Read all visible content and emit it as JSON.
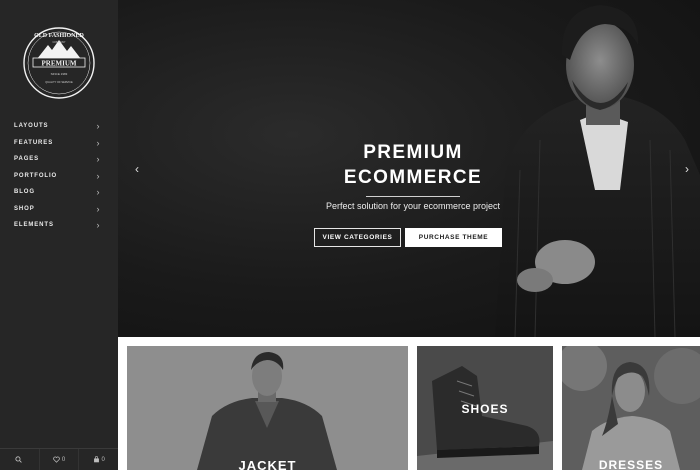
{
  "logo": {
    "brand_top": "OLD FASHIONED",
    "brand_sub": "COMPANY",
    "brand_main": "PREMIUM",
    "brand_since": "SINCE 1983",
    "brand_tag": "QUALITY OF SERVICE"
  },
  "sidebar": {
    "items": [
      {
        "label": "Layouts"
      },
      {
        "label": "Features"
      },
      {
        "label": "Pages"
      },
      {
        "label": "Portfolio"
      },
      {
        "label": "Blog"
      },
      {
        "label": "Shop"
      },
      {
        "label": "Elements"
      }
    ],
    "chevron": "›",
    "footer": {
      "search_icon": "search-icon",
      "wishlist_count": "0",
      "cart_count": "0"
    }
  },
  "hero": {
    "title_line1": "PREMIUM",
    "title_line2": "ECOMMERCE",
    "subtitle": "Perfect solution for your ecommerce project",
    "button_primary": "VIEW CATEGORIES",
    "button_secondary": "PURCHASE THEME",
    "prev_arrow": "‹",
    "next_arrow": "›"
  },
  "categories": [
    {
      "label": "JACKET"
    },
    {
      "label": "SHOES"
    },
    {
      "label": "DRESSES"
    }
  ],
  "colors": {
    "sidebar_bg": "#262626",
    "hero_bg": "#1a1a1a",
    "text_light": "#ffffff"
  }
}
